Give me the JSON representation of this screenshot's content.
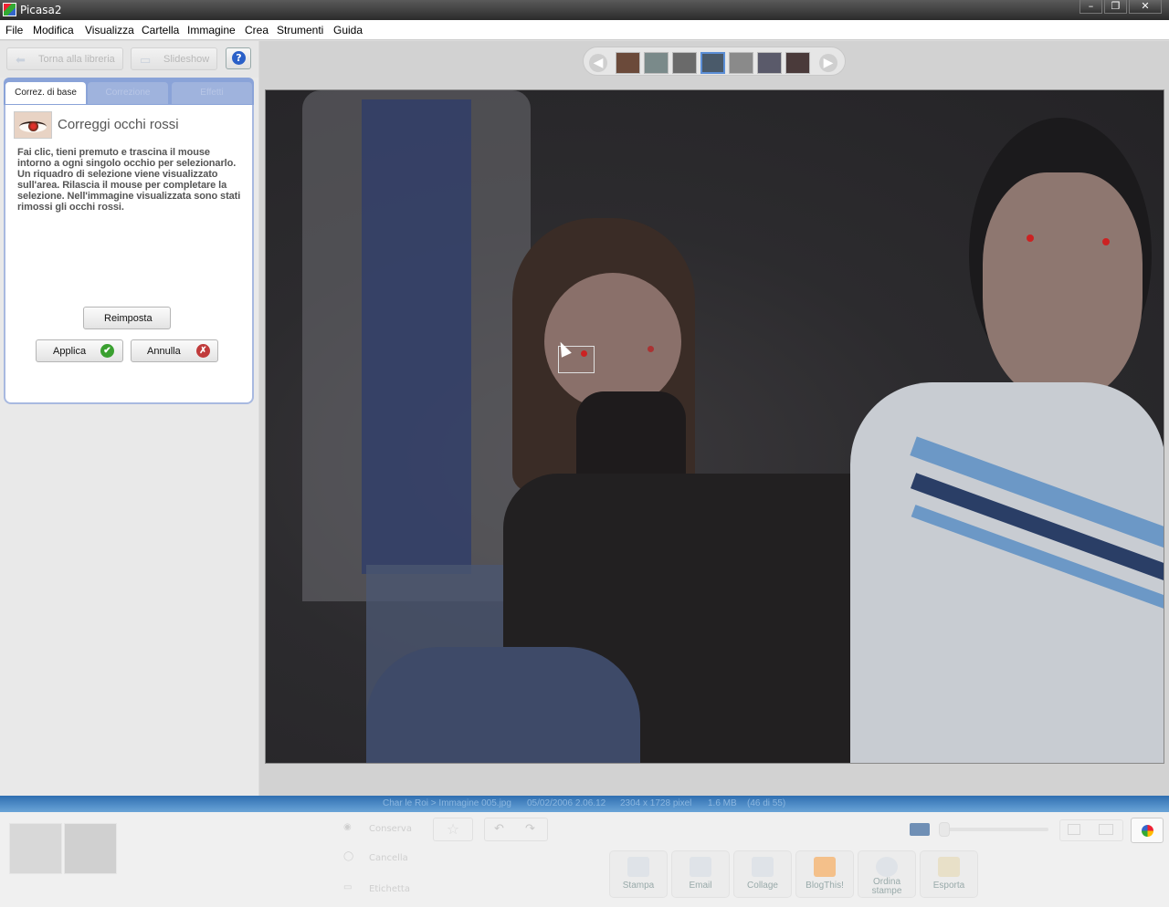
{
  "window": {
    "title": "Picasa2",
    "controls": [
      "–",
      "❐",
      "✕"
    ]
  },
  "menu": [
    "File",
    "Modifica",
    "Visualizza",
    "Cartella",
    "Immagine",
    "Crea",
    "Strumenti",
    "Guida"
  ],
  "toolbar": {
    "back_label": "Torna alla libreria",
    "slideshow_label": "Slideshow",
    "help_label": "?"
  },
  "tabs": {
    "basic": "Correz. di base",
    "tuning": "Correzione",
    "effects": "Effetti"
  },
  "tool": {
    "title": "Correggi occhi rossi",
    "description": "Fai clic, tieni premuto e trascina il mouse intorno a ogni singolo occhio per selezionarlo. Un riquadro di selezione viene visualizzato sull'area. Rilascia il mouse per completare la selezione. Nell'immagine visualizzata sono stati rimossi gli occhi rossi.",
    "reset_label": "Reimposta",
    "apply_label": "Applica",
    "cancel_label": "Annulla"
  },
  "status": {
    "path": "Char le Roi > Immagine 005.jpg",
    "date": "05/02/2006 2.06.12",
    "dimensions": "2304 x 1728 pixel",
    "size": "1.6 MB",
    "position": "(46 di 55)"
  },
  "tray": {
    "hold": "Conserva",
    "clear": "Cancella",
    "label": "Etichetta"
  },
  "actions": [
    "Stampa",
    "Email",
    "Collage",
    "BlogThis!",
    "Ordina stampe",
    "Esporta"
  ],
  "colors": {
    "accent": "#2f6fb1",
    "tab_bg": "#8aa3d8",
    "apply_icon": "#3aa030",
    "cancel_icon": "#c03a3a"
  }
}
